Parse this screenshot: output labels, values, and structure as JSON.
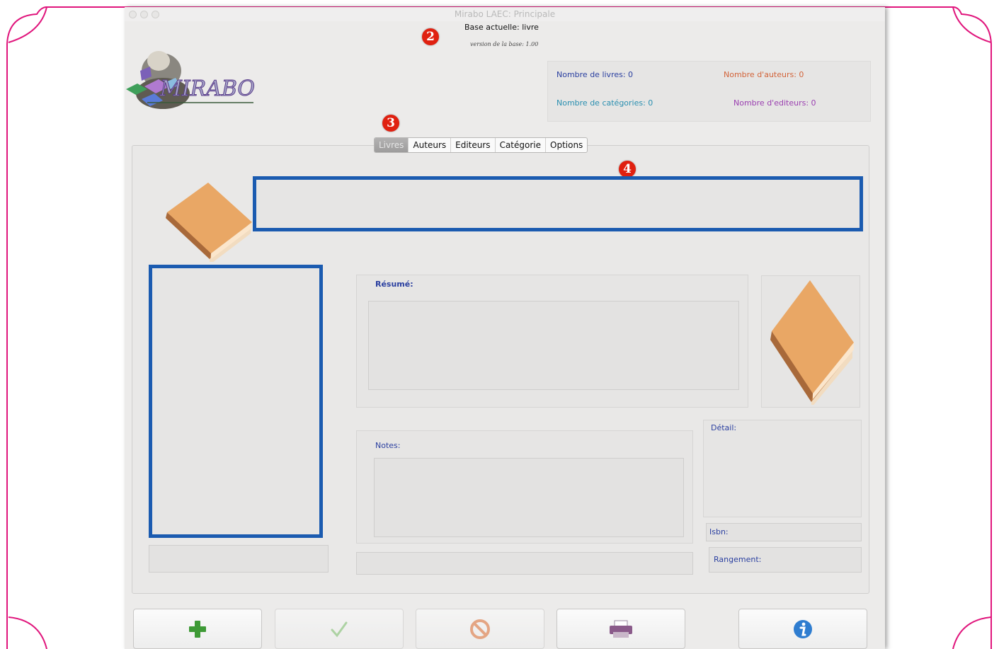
{
  "window": {
    "title": "Mirabo LAEC: Principale"
  },
  "header": {
    "base_label": "Base actuelle: livre",
    "version_label": "version de la base: 1.00",
    "logo_text": "MIRABO"
  },
  "markers": [
    "2",
    "3",
    "4"
  ],
  "stats": {
    "livres": "Nombre de livres: 0",
    "auteurs": "Nombre d'auteurs: 0",
    "categories": "Nombre de catégories: 0",
    "editeurs": "Nombre d'editeurs: 0"
  },
  "tabs": [
    "Livres",
    "Auteurs",
    "Editeurs",
    "Catégorie",
    "Options"
  ],
  "active_tab": "Livres",
  "fields": {
    "resume_label": "Résumé:",
    "notes_label": "Notes:",
    "detail_label": "Détail:",
    "isbn_label": "Isbn:",
    "rangement_label": "Rangement:"
  },
  "toolbar": [
    "add-icon",
    "check-icon",
    "cancel-icon",
    "print-icon",
    "info-icon"
  ],
  "colors": {
    "accent_blue": "#1b5bb0",
    "livres_stat": "#2a3fa0",
    "auteurs_stat": "#d2643a",
    "categories_stat": "#2a8fb0",
    "editeurs_stat": "#9a3fb0",
    "frame": "#e0157c"
  }
}
